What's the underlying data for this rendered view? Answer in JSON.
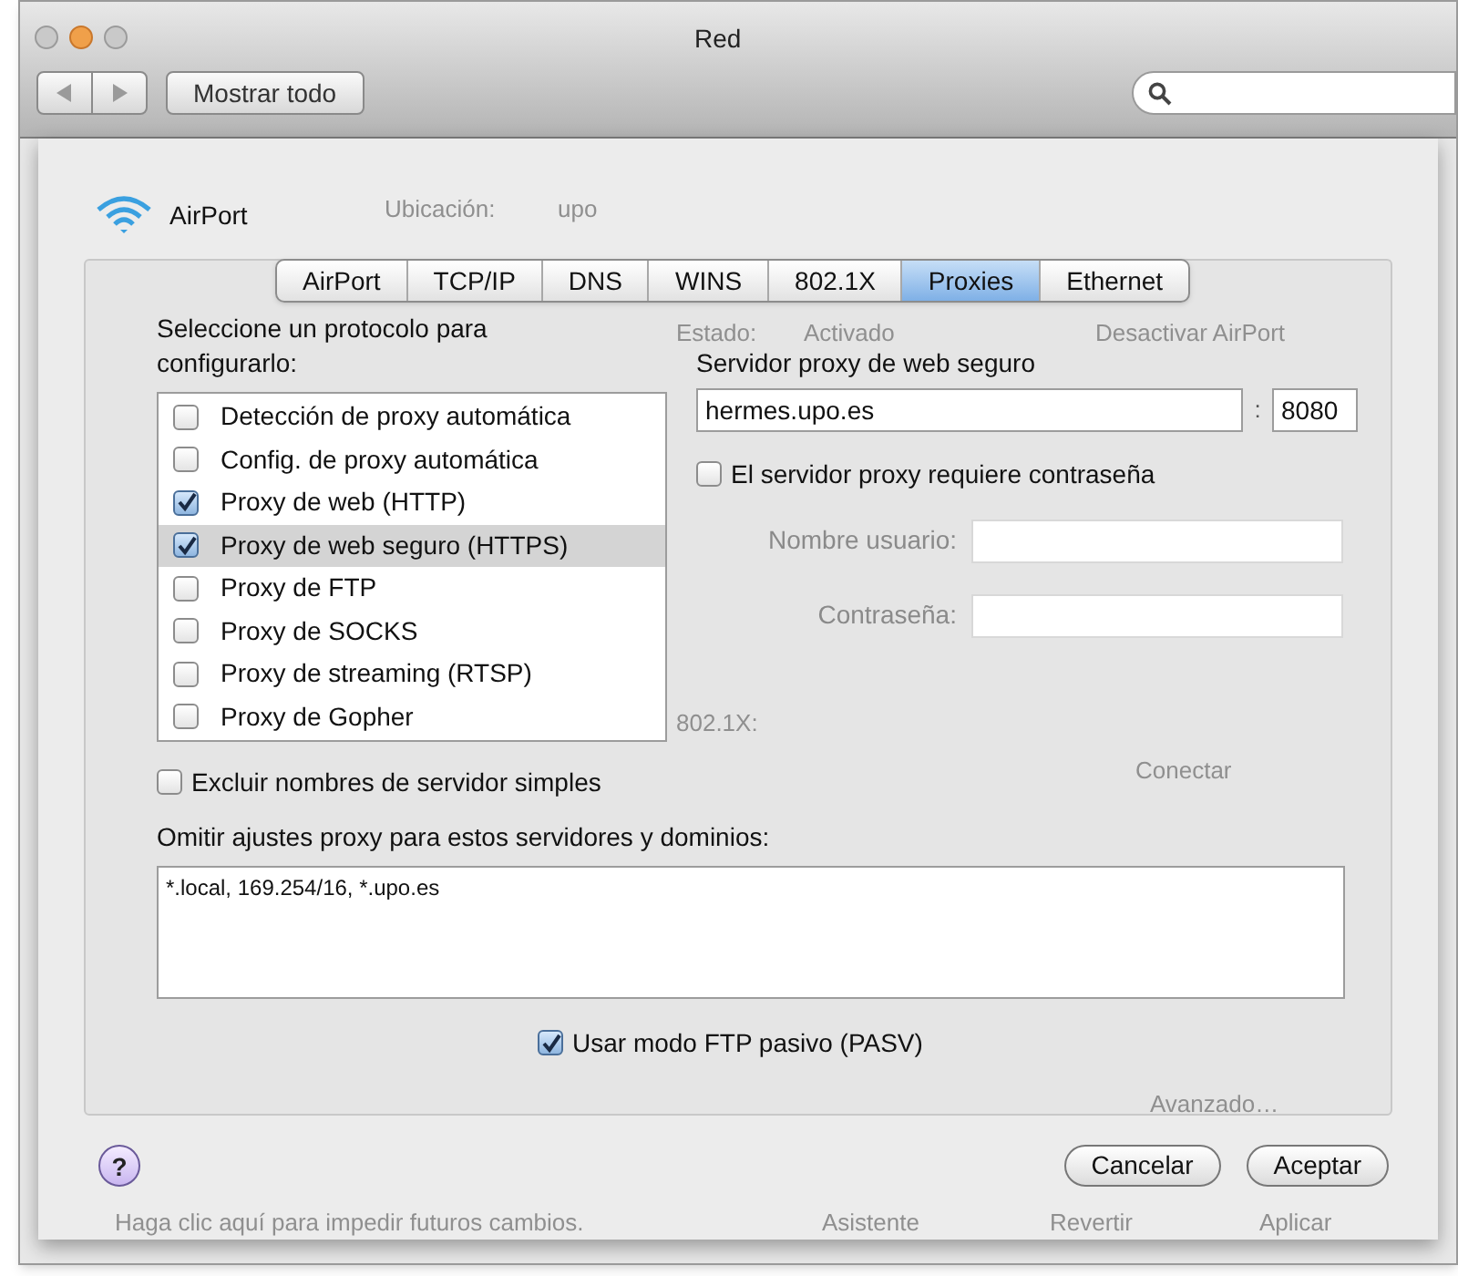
{
  "window": {
    "title": "Red"
  },
  "toolbar": {
    "show_all_button": "Mostrar todo"
  },
  "sheet": {
    "service": "AirPort",
    "tabs": [
      {
        "label": "AirPort",
        "selected": false
      },
      {
        "label": "TCP/IP",
        "selected": false
      },
      {
        "label": "DNS",
        "selected": false
      },
      {
        "label": "WINS",
        "selected": false
      },
      {
        "label": "802.1X",
        "selected": false
      },
      {
        "label": "Proxies",
        "selected": true
      },
      {
        "label": "Ethernet",
        "selected": false
      }
    ],
    "protocol_prompt": "Seleccione un protocolo para configurarlo:",
    "protocols": [
      {
        "label": "Detección de proxy automática",
        "checked": false,
        "selected": false
      },
      {
        "label": "Config. de proxy automática",
        "checked": false,
        "selected": false
      },
      {
        "label": "Proxy de web (HTTP)",
        "checked": true,
        "selected": false
      },
      {
        "label": "Proxy de web seguro (HTTPS)",
        "checked": true,
        "selected": true
      },
      {
        "label": "Proxy de FTP",
        "checked": false,
        "selected": false
      },
      {
        "label": "Proxy de SOCKS",
        "checked": false,
        "selected": false
      },
      {
        "label": "Proxy de streaming (RTSP)",
        "checked": false,
        "selected": false
      },
      {
        "label": "Proxy de Gopher",
        "checked": false,
        "selected": false
      }
    ],
    "server_label": "Servidor proxy de web seguro",
    "server": "hermes.upo.es",
    "port_separator": ":",
    "port": "8080",
    "password_required": {
      "label": "El servidor proxy requiere contraseña",
      "checked": false
    },
    "username": {
      "label": "Nombre usuario:",
      "disabled": true
    },
    "password": {
      "label": "Contraseña:",
      "disabled": true
    },
    "exclude_simple": {
      "label": "Excluir nombres de servidor simples",
      "checked": false
    },
    "bypass_label": "Omitir ajustes proxy para estos servidores y dominios:",
    "bypass_value": "*.local, 169.254/16, *.upo.es",
    "passive_ftp": {
      "label": "Usar modo FTP pasivo (PASV)",
      "checked": true
    },
    "help": "?",
    "buttons": [
      "Cancelar",
      "Aceptar"
    ]
  },
  "background": [
    "Ubicación:",
    "upo",
    "Estado:",
    "Activado",
    "Desactivar AirPort",
    "802.1X:",
    "Conectar",
    "Avanzado…",
    "Haga clic aquí para impedir futuros cambios.",
    "Asistente",
    "Revertir",
    "Aplicar"
  ]
}
